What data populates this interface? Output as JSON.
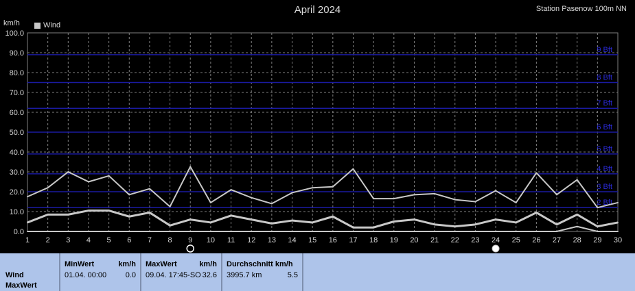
{
  "header": {
    "title": "April 2024",
    "station": "Station Pasenow 100m NN",
    "ylabel": "km/h",
    "legend": "Wind"
  },
  "colors": {
    "background": "#000000",
    "grid": "#808080",
    "beaufort_line": "#1a1aa0",
    "beaufort_text": "#2a2ad8",
    "series": "#c8c8c8",
    "panel": "#aec4ea"
  },
  "chart_data": {
    "type": "line",
    "title": "April 2024",
    "ylabel": "km/h",
    "xlabel": "",
    "ylim": [
      0,
      100
    ],
    "xlim": [
      1,
      30
    ],
    "yticks": [
      "0.0",
      "10.0",
      "20.0",
      "30.0",
      "40.0",
      "50.0",
      "60.0",
      "70.0",
      "80.0",
      "90.0",
      "100.0"
    ],
    "xticks": [
      "1",
      "2",
      "3",
      "4",
      "5",
      "6",
      "7",
      "8",
      "9",
      "10",
      "11",
      "12",
      "13",
      "14",
      "15",
      "16",
      "17",
      "18",
      "19",
      "20",
      "21",
      "22",
      "23",
      "24",
      "25",
      "26",
      "27",
      "28",
      "29",
      "30"
    ],
    "grid": true,
    "legend_position": "top-left",
    "x": [
      1,
      2,
      3,
      4,
      5,
      6,
      7,
      8,
      9,
      10,
      11,
      12,
      13,
      14,
      15,
      16,
      17,
      18,
      19,
      20,
      21,
      22,
      23,
      24,
      25,
      26,
      27,
      28,
      29,
      30
    ],
    "series": [
      {
        "name": "Wind",
        "role": "max",
        "values": [
          17.5,
          22,
          30,
          25,
          28,
          18.5,
          21.5,
          12.5,
          32.6,
          14.5,
          21,
          17,
          14,
          19.5,
          22,
          22.5,
          31.5,
          16.5,
          16.5,
          18.5,
          19,
          16,
          15,
          20.5,
          14.5,
          29.5,
          18.5,
          26,
          12,
          14.5
        ]
      },
      {
        "name": "",
        "role": "mean",
        "values": [
          4.5,
          8.5,
          8.5,
          10.5,
          10.5,
          7.5,
          9.5,
          3,
          6,
          4.5,
          8,
          6,
          4,
          5.5,
          4.5,
          7.5,
          2,
          2,
          5,
          6,
          3.5,
          2.5,
          3.5,
          6,
          4.5,
          9.5,
          3.5,
          8.5,
          2.5,
          4.5
        ]
      },
      {
        "name": "",
        "role": "min",
        "values": [
          0,
          0,
          0,
          0,
          0,
          0,
          0,
          0,
          0,
          0,
          0,
          0,
          0,
          0,
          0,
          0,
          0,
          0,
          0,
          0,
          0,
          0,
          0,
          0,
          0,
          0,
          0,
          2.5,
          0,
          0
        ]
      }
    ],
    "beaufort": [
      {
        "label": "2 Bft",
        "kmh": 12
      },
      {
        "label": "3 Bft",
        "kmh": 20
      },
      {
        "label": "4 Bft",
        "kmh": 29
      },
      {
        "label": "5 Bft",
        "kmh": 39
      },
      {
        "label": "6 Bft",
        "kmh": 50
      },
      {
        "label": "7 Bft",
        "kmh": 62
      },
      {
        "label": "8 Bft",
        "kmh": 75
      },
      {
        "label": "9 Bft",
        "kmh": 89
      }
    ],
    "moon_phases": [
      {
        "day": 9,
        "phase": "new-moon-icon"
      },
      {
        "day": 24,
        "phase": "full-moon-icon"
      }
    ]
  },
  "panel": {
    "row_labels": [
      "Wind",
      "MaxWert"
    ],
    "min": {
      "header": "MinWert",
      "unit": "km/h",
      "time": "01.04.  00:00",
      "value": "0.0"
    },
    "max": {
      "header": "MaxWert",
      "unit": "km/h",
      "time": "09.04.  17:45-SO",
      "value": "32.6"
    },
    "avg": {
      "header": "Durchschnitt km/h",
      "distance": "3995.7 km",
      "value": "5.5"
    }
  }
}
